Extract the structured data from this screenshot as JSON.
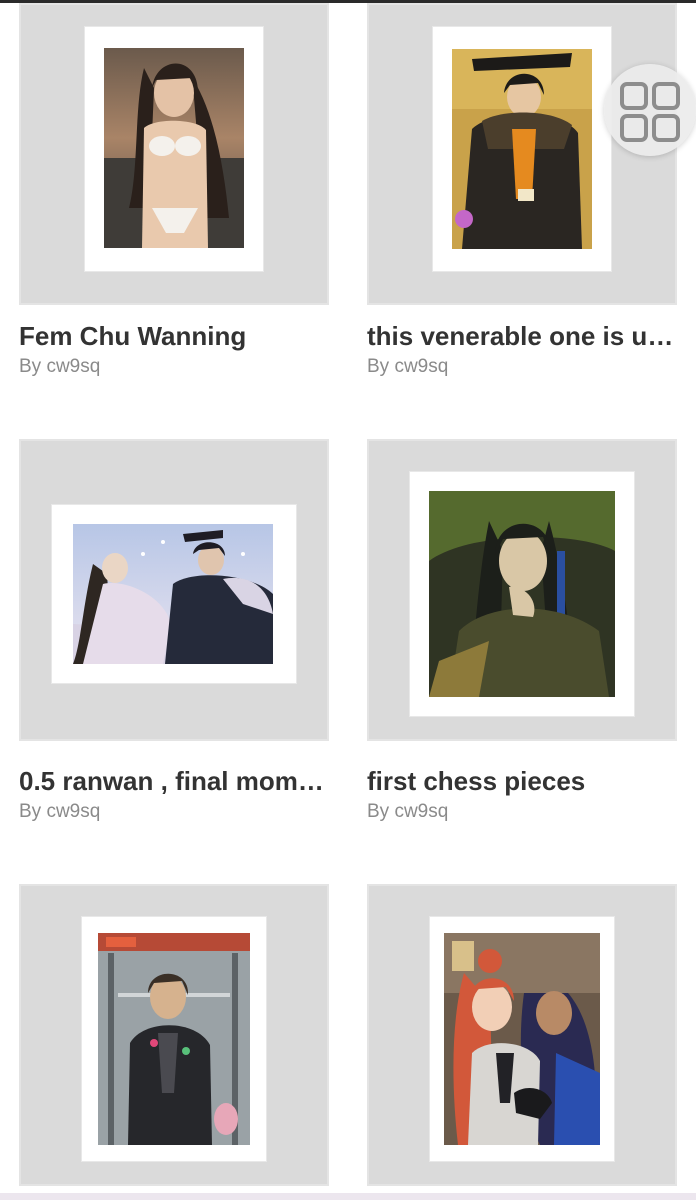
{
  "gallery": {
    "cards": [
      {
        "title": "Fem Chu Wanning",
        "author": "By cw9sq",
        "art_icon": "artwork-beach-portrait"
      },
      {
        "title": "this venerable one is un…",
        "author": "By cw9sq",
        "art_icon": "artwork-emperor-fur-coat"
      },
      {
        "title": "0.5 ranwan , final mom…",
        "author": "By cw9sq",
        "art_icon": "artwork-snow-embrace"
      },
      {
        "title": "first chess pieces",
        "author": "By cw9sq",
        "art_icon": "artwork-green-portrait"
      },
      {
        "title": "",
        "author": "",
        "art_icon": "artwork-elevator-scene"
      },
      {
        "title": "",
        "author": "",
        "art_icon": "artwork-two-characters"
      }
    ]
  },
  "controls": {
    "view_toggle_icon": "grid-view-icon"
  },
  "colors": {
    "thumb_bg": "#dadada",
    "title": "#333333",
    "author": "#8a8a8a"
  }
}
